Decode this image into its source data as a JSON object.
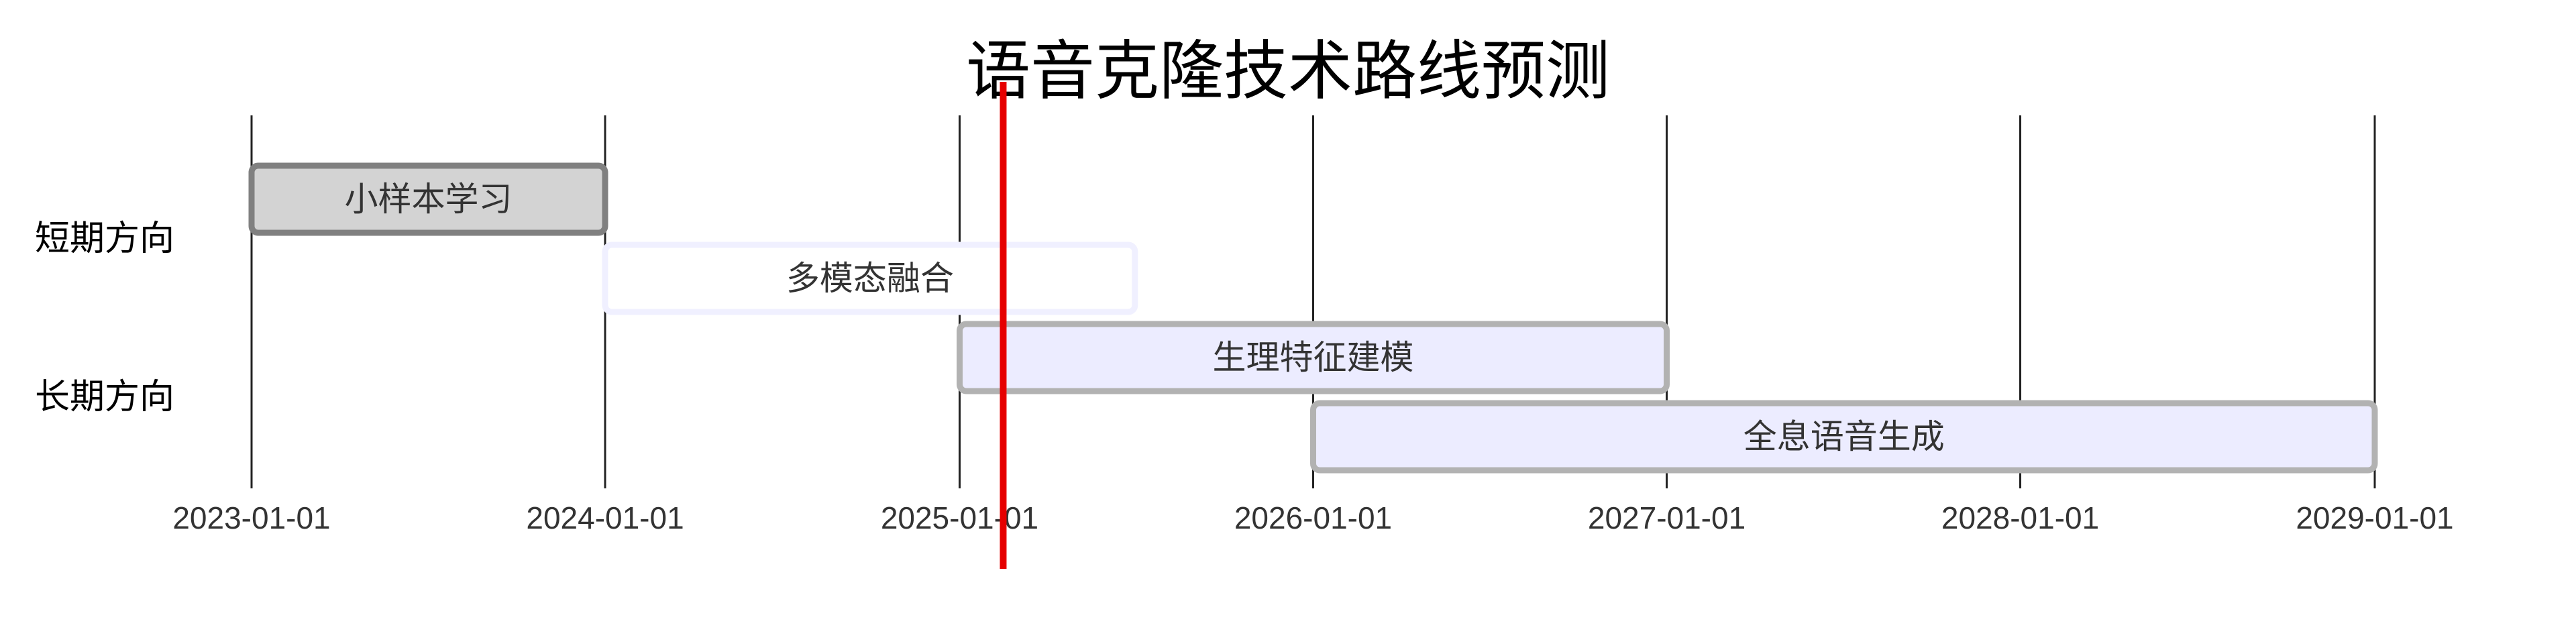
{
  "chart_data": {
    "type": "gantt",
    "title": "语音克隆技术路线预测",
    "x_axis": {
      "ticks": [
        "2023-01-01",
        "2024-01-01",
        "2025-01-01",
        "2026-01-01",
        "2027-01-01",
        "2028-01-01",
        "2029-01-01"
      ],
      "range": [
        "2023-01-01",
        "2029-01-01"
      ]
    },
    "grid": true,
    "today_marker": {
      "date": "2025-02-15",
      "color": "#e60000"
    },
    "sections": [
      {
        "name": "短期方向",
        "tasks": [
          {
            "label": "小样本学习",
            "start": "2023-01-01",
            "end": "2024-01-01",
            "status": "done"
          },
          {
            "label": "多模态融合",
            "start": "2024-01-01",
            "end": "2025-07-01",
            "status": "active"
          }
        ]
      },
      {
        "name": "长期方向",
        "tasks": [
          {
            "label": "生理特征建模",
            "start": "2025-01-01",
            "end": "2027-01-01",
            "status": "planned"
          },
          {
            "label": "全息语音生成",
            "start": "2026-01-01",
            "end": "2029-01-01",
            "status": "planned"
          }
        ]
      }
    ],
    "colors": {
      "done_fill": "#d3d3d3",
      "done_stroke": "#808080",
      "active_fill": "#ffffff",
      "active_stroke": "#f0f0ff",
      "planned_fill": "#ececff",
      "planned_stroke": "#b2b2b2",
      "grid": "#222222"
    }
  }
}
